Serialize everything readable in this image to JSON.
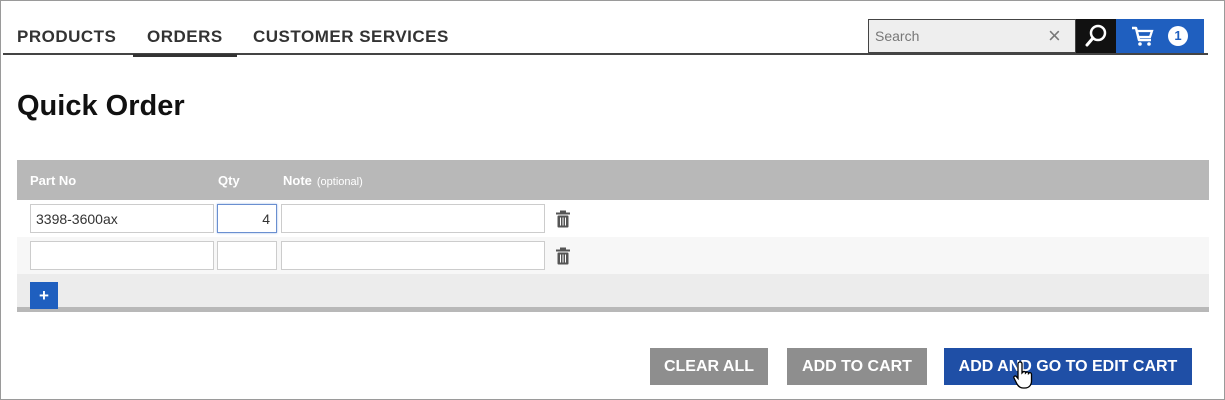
{
  "nav": {
    "items": [
      {
        "label": "PRODUCTS"
      },
      {
        "label": "ORDERS",
        "active": true
      },
      {
        "label": "CUSTOMER SERVICES"
      }
    ]
  },
  "search": {
    "placeholder": "Search",
    "value": "",
    "clear_icon": "close-icon",
    "button_icon": "search-icon"
  },
  "cart": {
    "icon": "cart-icon",
    "count": "1",
    "color": "#1f5fbf"
  },
  "page": {
    "title": "Quick Order"
  },
  "table": {
    "headers": {
      "part": "Part No",
      "qty": "Qty",
      "note": "Note",
      "note_hint": "(optional)"
    },
    "rows": [
      {
        "part": "3398-3600ax",
        "qty": "4",
        "note": ""
      },
      {
        "part": "",
        "qty": "",
        "note": ""
      }
    ],
    "add_row_label": "+"
  },
  "buttons": {
    "clear_all": "CLEAR ALL",
    "add_to_cart": "ADD TO CART",
    "add_and_edit": "ADD AND GO TO EDIT CART"
  },
  "colors": {
    "accent": "#1f5fbf",
    "header_gray": "#b8b8b8",
    "button_gray": "#8e8e8e"
  }
}
